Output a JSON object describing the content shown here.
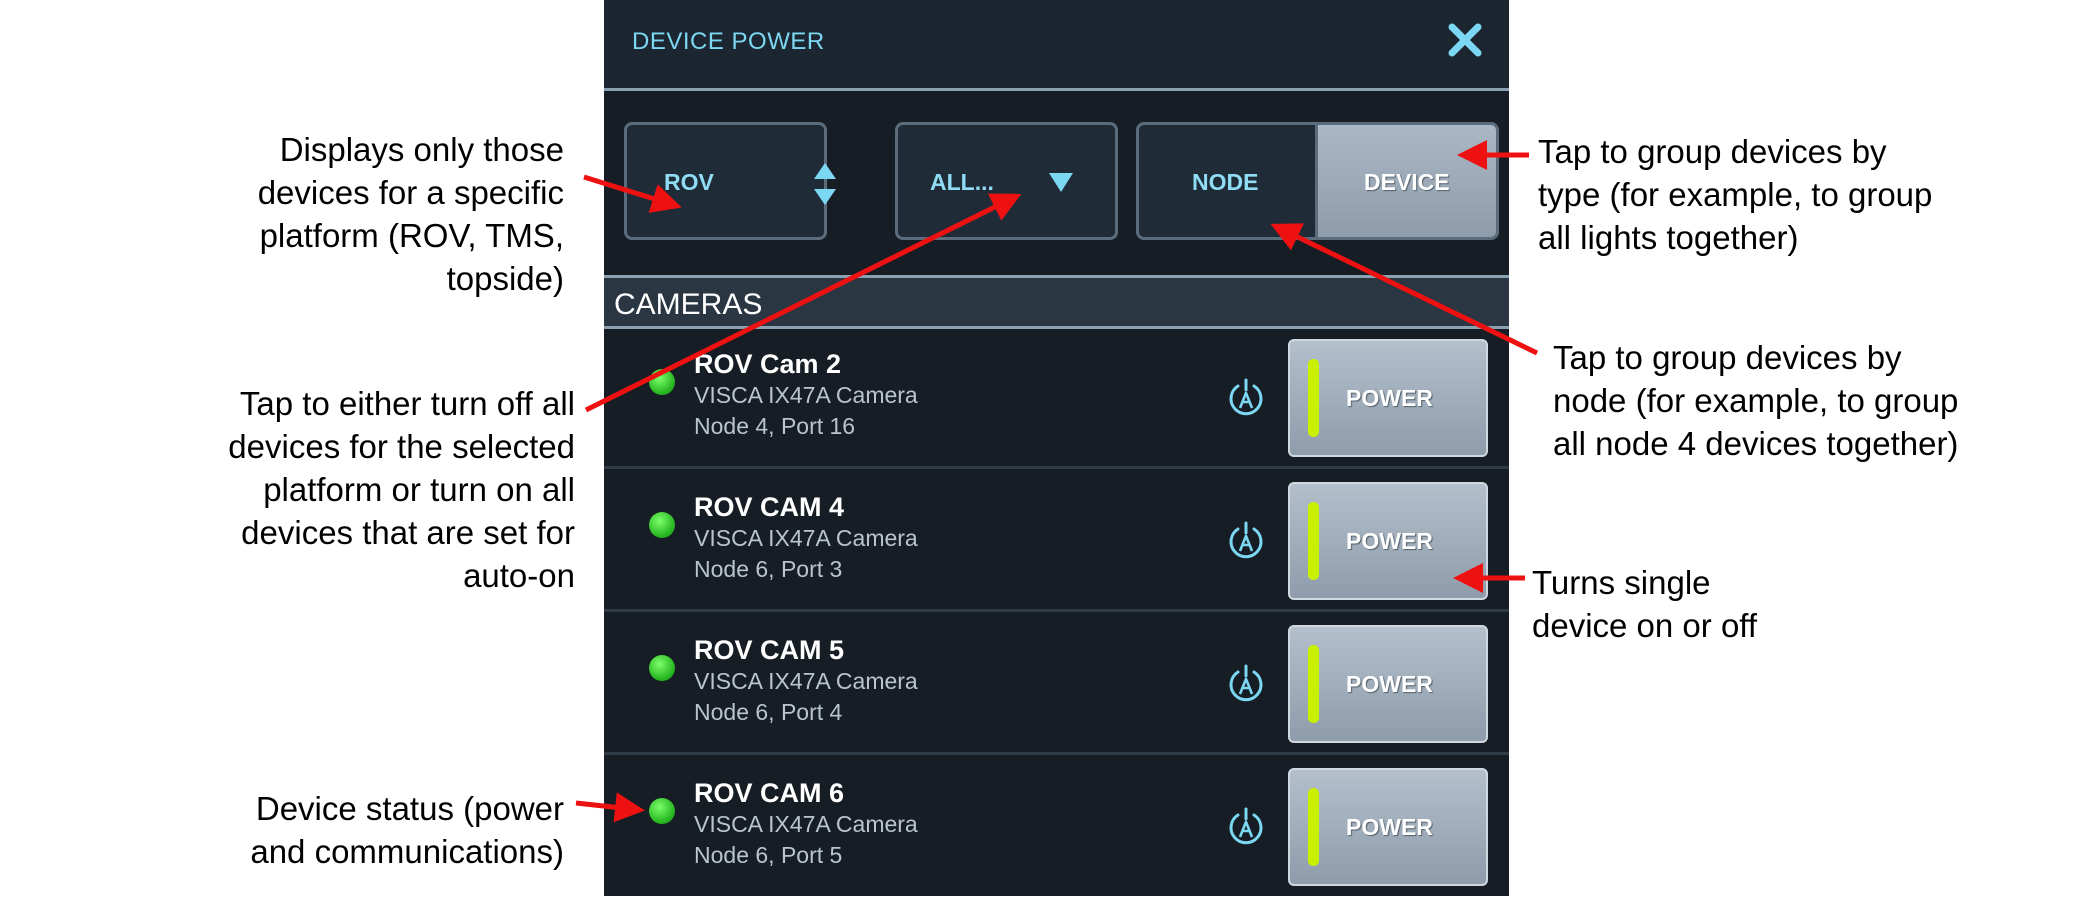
{
  "window": {
    "title": "DEVICE POWER"
  },
  "controls": {
    "platform_value": "ROV",
    "all_label": "ALL...",
    "node_label": "NODE",
    "device_label": "DEVICE"
  },
  "section": {
    "label": "CAMERAS"
  },
  "devices": [
    {
      "name": "ROV Cam 2",
      "type": "VISCA IX47A Camera",
      "node": "Node 4, Port 16",
      "power_label": "POWER"
    },
    {
      "name": "ROV CAM 4",
      "type": "VISCA IX47A Camera",
      "node": "Node 6, Port 3",
      "power_label": "POWER"
    },
    {
      "name": "ROV CAM 5",
      "type": "VISCA IX47A Camera",
      "node": "Node 6, Port 4",
      "power_label": "POWER"
    },
    {
      "name": "ROV CAM 6",
      "type": "VISCA IX47A Camera",
      "node": "Node 6, Port 5",
      "power_label": "POWER"
    }
  ],
  "annotations": {
    "platform": [
      "Displays only those",
      "devices for a specific",
      "platform (ROV, TMS,",
      "topside)"
    ],
    "all_toggle": [
      "Tap to either turn off all",
      "devices for the selected",
      "platform or turn on all",
      "devices that are set for",
      "auto-on"
    ],
    "status": [
      "Device status (power",
      "and communications)"
    ],
    "device_group": [
      "Tap to group devices by",
      "type (for example, to group",
      "all lights together)"
    ],
    "node_group": [
      "Tap to group devices by",
      "node (for example, to group",
      "all node 4 devices together)"
    ],
    "power": [
      "Turns single",
      "device on or off"
    ]
  },
  "colors": {
    "accent": "#7cd7f2",
    "status_led": "#33cc22",
    "power_indicator": "#c8f000",
    "callout": "#ee1111"
  }
}
